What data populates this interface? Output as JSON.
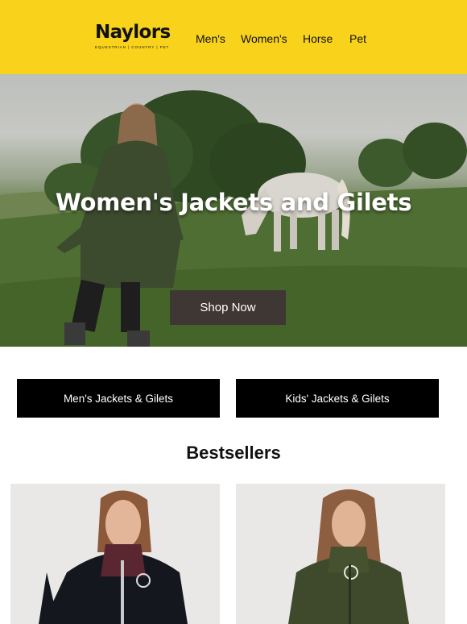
{
  "brand": {
    "name": "Naylors",
    "tagline": "EQUESTRIAN | COUNTRY | PET"
  },
  "nav": {
    "items": [
      "Men's",
      "Women's",
      "Horse",
      "Pet"
    ]
  },
  "hero": {
    "title": "Women's Jackets and Gilets",
    "cta_label": "Shop Now"
  },
  "categories": [
    "Men's Jackets & Gilets",
    "Kids' Jackets & Gilets"
  ],
  "bestsellers": {
    "title": "Bestsellers"
  },
  "colors": {
    "header_bg": "#f9d21b",
    "cta_bg": "#3f3734",
    "category_bg": "#000000"
  }
}
